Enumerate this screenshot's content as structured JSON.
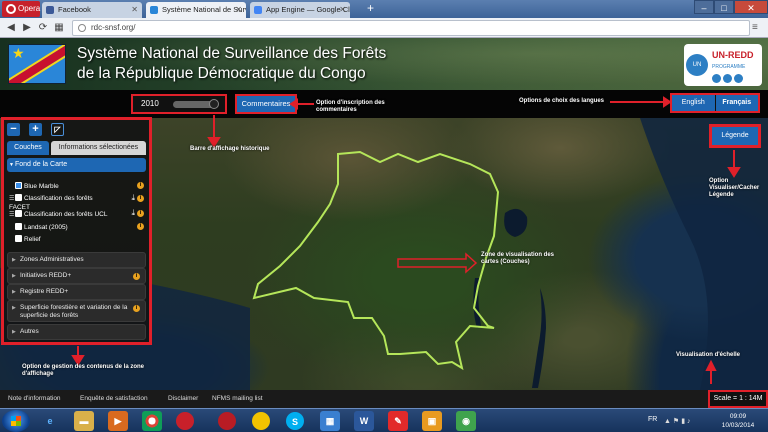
{
  "browser": {
    "menu_label": "Opera",
    "tabs": [
      {
        "title": "Facebook",
        "active": false
      },
      {
        "title": "Système National de Surv",
        "active": true
      },
      {
        "title": "App Engine — Google Clo",
        "active": false
      }
    ],
    "url": "rdc-snsf.org/",
    "window_controls": {
      "minimize": "–",
      "maximize": "□",
      "close": "✕"
    }
  },
  "header": {
    "title_line1": "Système National de Surveillance des Forêts",
    "title_line2": "de la République Démocratique du Congo",
    "partner_logo_text": "UN-REDD",
    "partner_logo_sub": "PROGRAMME",
    "partner_logo_un": "UN"
  },
  "toolbar": {
    "year": "2010",
    "comments_label": "Commentaires",
    "languages": {
      "english": "English",
      "french": "Français"
    }
  },
  "panel": {
    "tabs": {
      "layers": "Couches",
      "selected_info": "Informations sélectionées"
    },
    "base_section": "Fond de la Carte",
    "layers": [
      {
        "label": "Blue Marble",
        "checked": true
      },
      {
        "label": "Classification des forêts FACET",
        "checked": false
      },
      {
        "label": "Classification des forêts UCL",
        "checked": false
      },
      {
        "label": "Landsat (2005)",
        "checked": false
      },
      {
        "label": "Relief",
        "checked": false
      }
    ],
    "sections": [
      "Zones Administratives",
      "Initiatives REDD+",
      "Registre REDD+",
      "Superficie forestière et variation de la superficie des forêts",
      "Autres"
    ],
    "info_glyph": "i",
    "download_glyph": "⤓"
  },
  "map": {
    "legend_label": "Légende",
    "scale_text": "Scale = 1 : 14M"
  },
  "annotations": {
    "historic_bar": "Barre d'affichage historique",
    "comments_option": "Option d'inscription des commentaires",
    "languages_option": "Options de choix des langues",
    "legend_option": "Option Visualiser/Cacher Légende",
    "map_zone": "Zone de visualisation des cartes (Couches)",
    "panel_option": "Option de gestion des contenus de la zone d'affichage",
    "scale_option": "Visualisation d'échelle"
  },
  "footer": {
    "links": [
      "Note d'information",
      "Enquête de satisfaction",
      "Disclaimer",
      "NFMS mailing list"
    ]
  },
  "taskbar": {
    "language": "FR",
    "time": "09:09",
    "date": "10/03/2014"
  },
  "colors": {
    "accent_blue": "#1e67b3",
    "annotation_red": "#e0202a",
    "border_green": "#b5e65a"
  }
}
